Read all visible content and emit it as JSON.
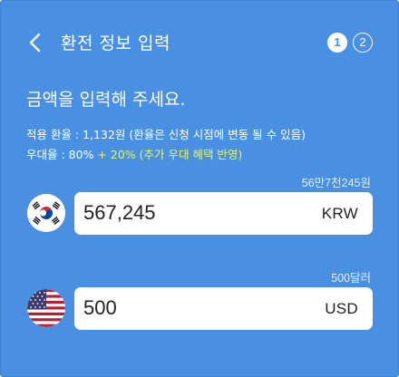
{
  "header": {
    "title": "환전 정보 입력",
    "back_icon": "chevron-left-icon",
    "steps": [
      "1",
      "2"
    ],
    "current_step": "1"
  },
  "main": {
    "headline": "금액을 입력해 주세요.",
    "exchange_rate_text": "적용 환율 : 1,132원 (환율은 신청 시점에 변동 될 수 있음)",
    "preferential_prefix": "우대율 : 80% ",
    "preferential_bonus": "+ 20% (추가 우대 혜택 반영)"
  },
  "krw": {
    "hint": "56만7천245원",
    "value": "567,245",
    "currency": "KRW",
    "flag_icon": "south-korea-flag-icon"
  },
  "usd": {
    "hint": "500달러",
    "value": "500",
    "currency": "USD",
    "flag_icon": "united-states-flag-icon"
  },
  "colors": {
    "background": "#4a90e2",
    "bonus_highlight": "#e7f566",
    "input_background": "#ffffff"
  }
}
